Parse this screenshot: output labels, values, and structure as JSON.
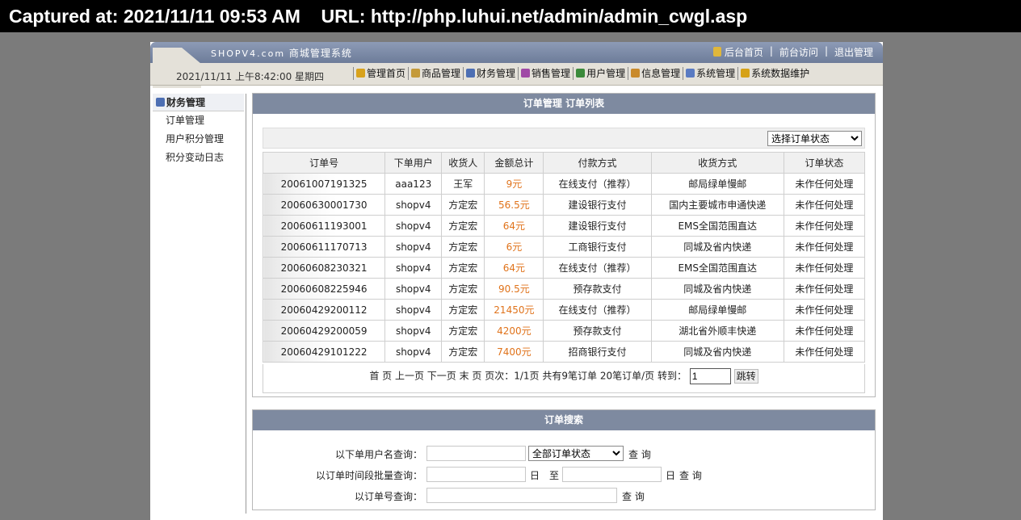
{
  "capture": {
    "text": "Captured at: 2021/11/11 09:53 AM    URL: http://php.luhui.net/admin/admin_cwgl.asp"
  },
  "header": {
    "logo": "SHOPV4.com",
    "system_name": "商城管理系统",
    "links": [
      "后台首页",
      "前台访问",
      "退出管理"
    ],
    "datetime": "2021/11/11 上午8:42:00 星期四",
    "nav": [
      {
        "label": "管理首页",
        "color": "#d8a21c"
      },
      {
        "label": "商品管理",
        "color": "#c49a3a"
      },
      {
        "label": "财务管理",
        "color": "#4d6fb3"
      },
      {
        "label": "销售管理",
        "color": "#a04aa6"
      },
      {
        "label": "用户管理",
        "color": "#3b8a3b"
      },
      {
        "label": "信息管理",
        "color": "#c98a2b"
      },
      {
        "label": "系统管理",
        "color": "#5a7bc2"
      },
      {
        "label": "系统数据维护",
        "color": "#d6a217"
      }
    ]
  },
  "sidebar": {
    "title": "财务管理",
    "items": [
      "订单管理",
      "用户积分管理",
      "积分变动日志"
    ]
  },
  "orders": {
    "title": "订单管理 订单列表",
    "status_select": "选择订单状态",
    "columns": [
      "订单号",
      "下单用户",
      "收货人",
      "金额总计",
      "付款方式",
      "收货方式",
      "订单状态"
    ],
    "rows": [
      [
        "20061007191325",
        "aaa123",
        "王军",
        "9元",
        "在线支付（推荐）",
        "邮局绿单慢邮",
        "未作任何处理"
      ],
      [
        "20060630001730",
        "shopv4",
        "方定宏",
        "56.5元",
        "建设银行支付",
        "国内主要城市申通快递",
        "未作任何处理"
      ],
      [
        "20060611193001",
        "shopv4",
        "方定宏",
        "64元",
        "建设银行支付",
        "EMS全国范围直达",
        "未作任何处理"
      ],
      [
        "20060611170713",
        "shopv4",
        "方定宏",
        "6元",
        "工商银行支付",
        "同城及省内快递",
        "未作任何处理"
      ],
      [
        "20060608230321",
        "shopv4",
        "方定宏",
        "64元",
        "在线支付（推荐）",
        "EMS全国范围直达",
        "未作任何处理"
      ],
      [
        "20060608225946",
        "shopv4",
        "方定宏",
        "90.5元",
        "预存款支付",
        "同城及省内快递",
        "未作任何处理"
      ],
      [
        "20060429200112",
        "shopv4",
        "方定宏",
        "21450元",
        "在线支付（推荐）",
        "邮局绿单慢邮",
        "未作任何处理"
      ],
      [
        "20060429200059",
        "shopv4",
        "方定宏",
        "4200元",
        "预存款支付",
        "湖北省外顺丰快递",
        "未作任何处理"
      ],
      [
        "20060429101222",
        "shopv4",
        "方定宏",
        "7400元",
        "招商银行支付",
        "同城及省内快递",
        "未作任何处理"
      ]
    ],
    "pager": {
      "text": "首 页 上一页 下一页 末 页 页次：1/1页 共有9笔订单 20笔订单/页 转到：",
      "page_value": "1",
      "go_label": "跳转"
    }
  },
  "search": {
    "title": "订单搜索",
    "user_label": "以下单用户名查询：",
    "status_option": "全部订单状态",
    "query_label": "查 询",
    "date_label": "以订单时间段批量查询：",
    "day": "日",
    "to": "至",
    "order_label": "以订单号查询："
  }
}
